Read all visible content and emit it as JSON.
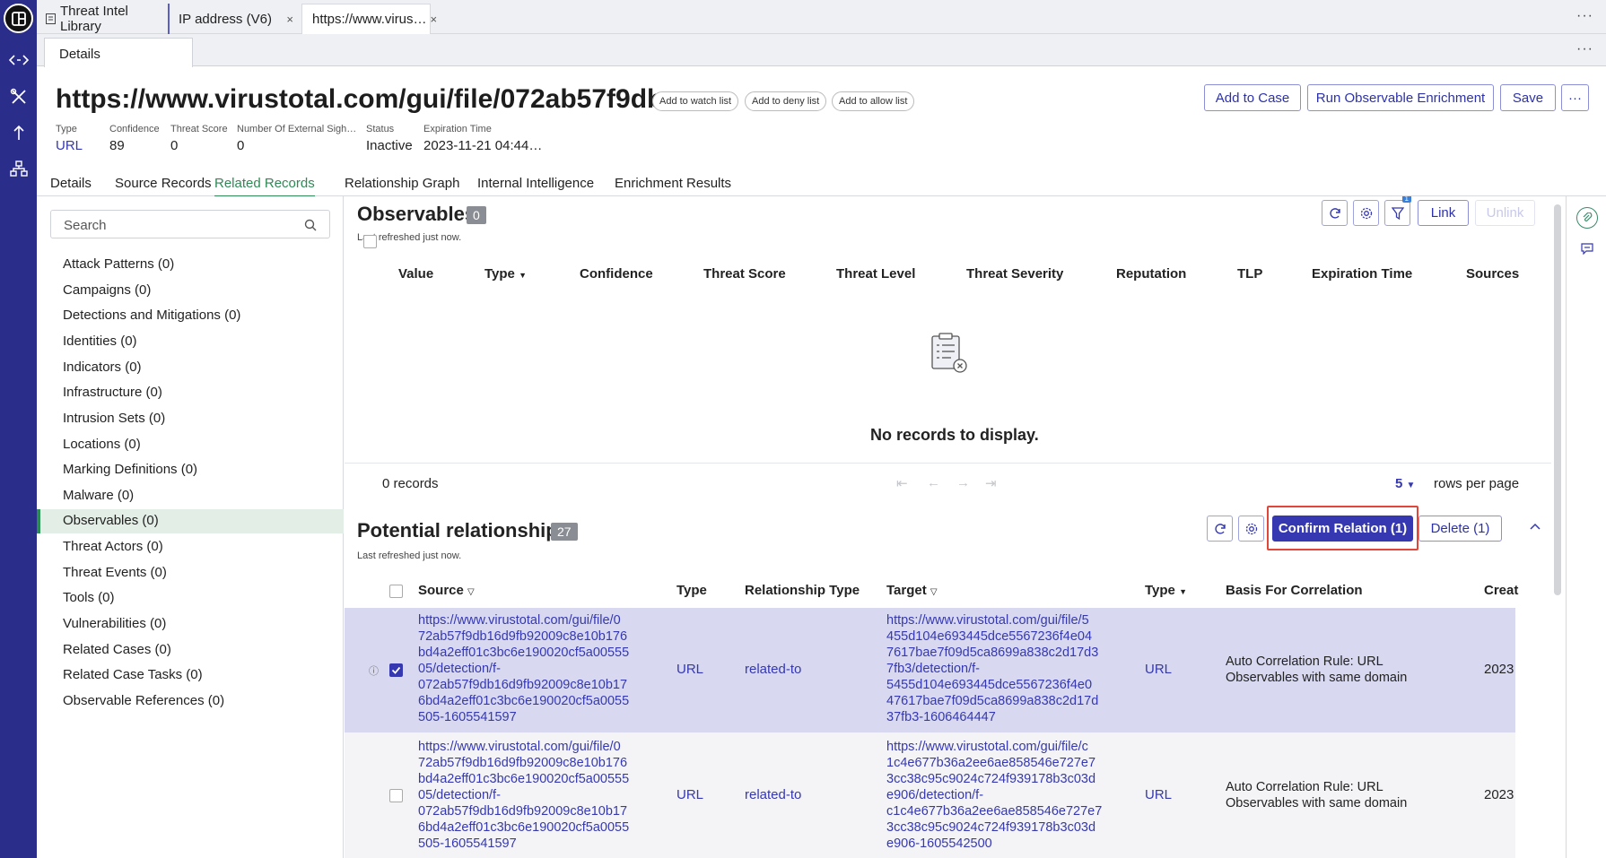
{
  "tabs": [
    {
      "label": "Threat Intel Library"
    },
    {
      "label": "IP address (V6)",
      "close": "×"
    },
    {
      "label": "https://www.virus…",
      "close": "×"
    }
  ],
  "subtab": {
    "label": "Details",
    "more": "···"
  },
  "top_more": "···",
  "header": {
    "title": "https://www.virustotal.com/gui/file/072ab57f9db…",
    "pills": [
      "Add to watch list",
      "Add to deny list",
      "Add to allow list"
    ],
    "actions": {
      "add_case": "Add to Case",
      "enrich": "Run Observable Enrichment",
      "save": "Save",
      "more": "···"
    },
    "meta": [
      {
        "key": "Type",
        "value": "URL"
      },
      {
        "key": "Confidence",
        "value": "89"
      },
      {
        "key": "Threat Score",
        "value": "0"
      },
      {
        "key": "Number Of External Sigh…",
        "value": "0"
      },
      {
        "key": "Status",
        "value": "Inactive"
      },
      {
        "key": "Expiration Time",
        "value": "2023-11-21 04:44…"
      }
    ]
  },
  "page_tabs": [
    "Details",
    "Source Records",
    "Related Records",
    "Relationship Graph",
    "Internal Intelligence",
    "Enrichment Results"
  ],
  "active_page_tab": "Related Records",
  "sidebar": {
    "search_placeholder": "Search",
    "items": [
      "Attack Patterns (0)",
      "Campaigns (0)",
      "Detections and Mitigations (0)",
      "Identities (0)",
      "Indicators (0)",
      "Infrastructure (0)",
      "Intrusion Sets (0)",
      "Locations (0)",
      "Marking Definitions (0)",
      "Malware (0)",
      "Observables (0)",
      "Threat Actors (0)",
      "Threat Events (0)",
      "Tools (0)",
      "Vulnerabilities (0)",
      "Related Cases (0)",
      "Related Case Tasks (0)",
      "Observable References (0)"
    ],
    "active": "Observables (0)"
  },
  "observables": {
    "title": "Observables",
    "count": "0",
    "refreshed": "Last refreshed just now.",
    "link": "Link",
    "unlink": "Unlink",
    "filter_badge": "1",
    "columns": [
      "Value",
      "Type",
      "Confidence",
      "Threat Score",
      "Threat Level",
      "Threat Severity",
      "Reputation",
      "TLP",
      "Expiration Time",
      "Sources"
    ],
    "empty": "No records to display.",
    "records": "0 records",
    "rows_per_page": "5",
    "rows_per_page_label": "rows per page"
  },
  "potential": {
    "title": "Potential relationships",
    "count": "27",
    "refreshed": "Last refreshed just now.",
    "confirm": "Confirm Relation (1)",
    "delete": "Delete (1)",
    "columns": [
      "Source",
      "Type",
      "Relationship Type",
      "Target",
      "Type",
      "Basis For Correlation",
      "Creat"
    ],
    "rows": [
      {
        "selected": true,
        "source": "https://www.virustotal.com/gui/file/0\n72ab57f9db16d9fb92009c8e10b176\nbd4a2eff01c3bc6e190020cf5a00555\n05/detection/f-\n072ab57f9db16d9fb92009c8e10b17\n6bd4a2eff01c3bc6e190020cf5a0055\n505-1605541597",
        "source_type": "URL",
        "relationship": "related-to",
        "target": "https://www.virustotal.com/gui/file/5\n455d104e693445dce5567236f4e04\n7617bae7f09d5ca8699a838c2d17d3\n7fb3/detection/f-\n5455d104e693445dce5567236f4e0\n47617bae7f09d5ca8699a838c2d17d\n37fb3-1606464447",
        "target_type": "URL",
        "basis": "Auto Correlation Rule: URL\nObservables with same domain",
        "created": "2023"
      },
      {
        "selected": false,
        "source": "https://www.virustotal.com/gui/file/0\n72ab57f9db16d9fb92009c8e10b176\nbd4a2eff01c3bc6e190020cf5a00555\n05/detection/f-\n072ab57f9db16d9fb92009c8e10b17\n6bd4a2eff01c3bc6e190020cf5a0055\n505-1605541597",
        "source_type": "URL",
        "relationship": "related-to",
        "target": "https://www.virustotal.com/gui/file/c\n1c4e677b36a2ee6ae858546e727e7\n3cc38c95c9024c724f939178b3c03d\ne906/detection/f-\nc1c4e677b36a2ee6ae858546e727e7\n3cc38c95c9024c724f939178b3c03d\ne906-1605542500",
        "target_type": "URL",
        "basis": "Auto Correlation Rule: URL\nObservables with same domain",
        "created": "2023"
      }
    ]
  },
  "colors": {
    "accent": "#3538b0",
    "rail": "#2b2d8a",
    "active_tab": "#2d8a55",
    "highlight": "#e0473a"
  }
}
